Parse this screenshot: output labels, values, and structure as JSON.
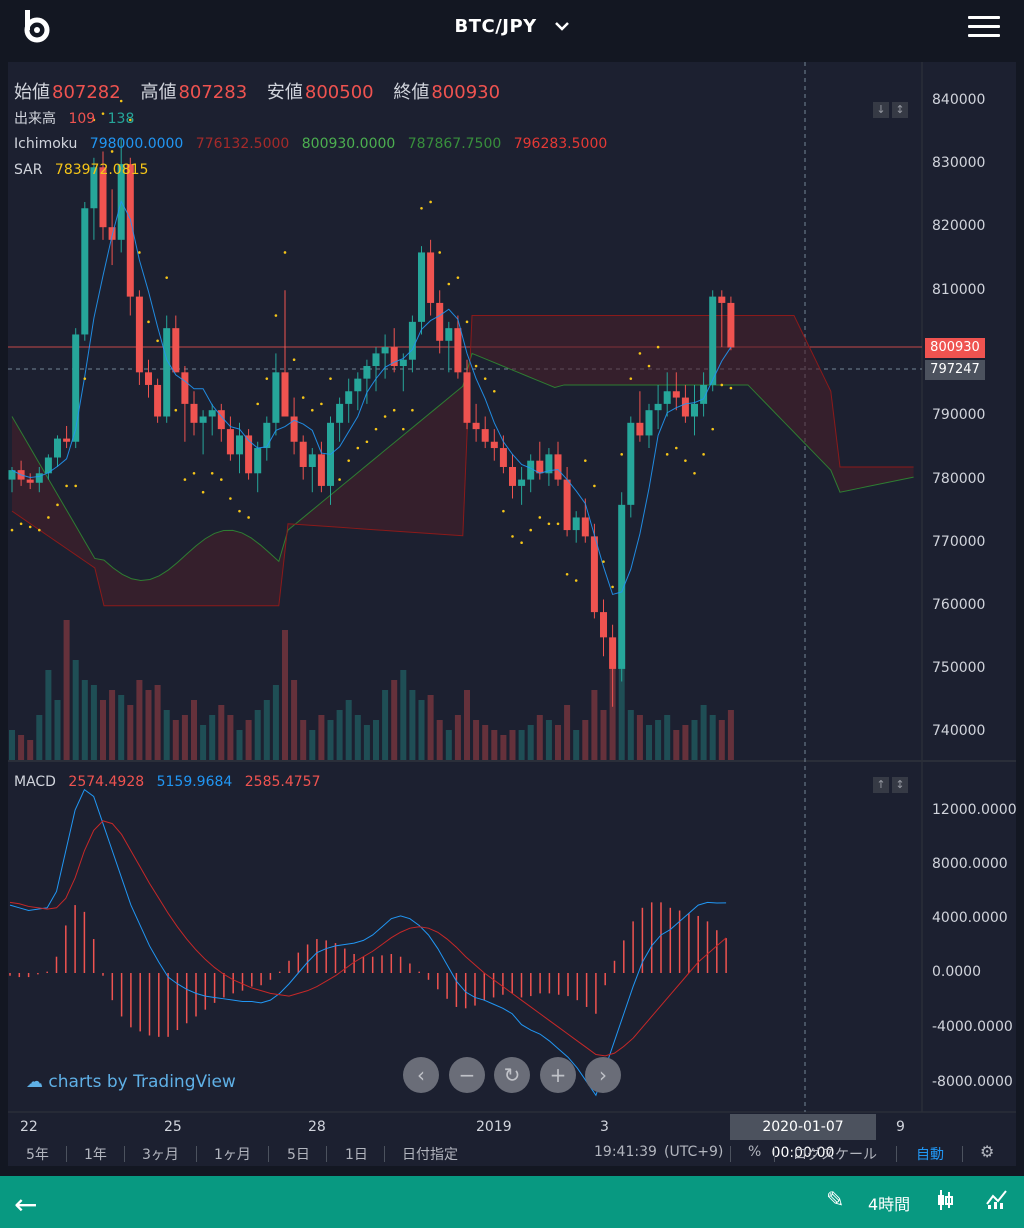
{
  "header": {
    "pair": "BTC/JPY",
    "logo": "bitbank-logo",
    "menu_icon": "hamburger-menu-icon"
  },
  "ohlc": {
    "open_label": "始値",
    "open": "807282",
    "high_label": "高値",
    "high": "807283",
    "low_label": "安値",
    "low": "800500",
    "close_label": "終値",
    "close": "800930"
  },
  "volume": {
    "label": "出来高",
    "v1": "109",
    "v2": "138"
  },
  "ichimoku": {
    "label": "Ichimoku",
    "v1": "798000.0000",
    "v2": "776132.5000",
    "v3": "800930.0000",
    "v4": "787867.7500",
    "v5": "796283.5000"
  },
  "sar": {
    "label": "SAR",
    "value": "783972.0815"
  },
  "macd": {
    "label": "MACD",
    "v1": "2574.4928",
    "v2": "5159.9684",
    "v3": "2585.4757"
  },
  "price_axis": [
    "840000",
    "830000",
    "820000",
    "810000",
    "800930",
    "797247",
    "790000",
    "780000",
    "770000",
    "760000",
    "750000",
    "740000"
  ],
  "macd_axis": [
    "12000.0000",
    "8000.0000",
    "4000.0000",
    "0.0000",
    "-4000.0000",
    "-8000.0000"
  ],
  "time_axis": [
    "22",
    "25",
    "28",
    "2019",
    "3",
    "9"
  ],
  "crosshair_time": "2020-01-07 00:00:00",
  "tradingview": "charts by TradingView",
  "toolbar": {
    "r5y": "5年",
    "r1y": "1年",
    "r3m": "3ヶ月",
    "r1m": "1ヶ月",
    "r5d": "5日",
    "r1d": "1日",
    "custom": "日付指定",
    "clock": "19:41:39",
    "tz": "(UTC+9)",
    "pct": "%",
    "log": "ログスケール",
    "auto": "自動"
  },
  "bottom": {
    "period": "4時間"
  },
  "colors": {
    "up": "#26a69a",
    "down": "#ef5350",
    "sar": "#f5c518",
    "bg": "#131722",
    "accent": "#089981",
    "auto": "#2196f3"
  },
  "chart_data": [
    {
      "type": "candlestick",
      "title": "BTC/JPY",
      "ylim": [
        735000,
        845000
      ],
      "candles": [
        [
          780000,
          782000,
          778000,
          781500
        ],
        [
          781500,
          783000,
          779000,
          780000
        ],
        [
          780000,
          781000,
          778500,
          779500
        ],
        [
          779500,
          782000,
          778000,
          781000
        ],
        [
          781000,
          784000,
          780000,
          783500
        ],
        [
          783500,
          787000,
          782000,
          786500
        ],
        [
          786500,
          788500,
          785000,
          786000
        ],
        [
          786000,
          804000,
          785000,
          803000
        ],
        [
          803000,
          824000,
          802000,
          823000
        ],
        [
          823000,
          831000,
          818000,
          829500
        ],
        [
          829500,
          832000,
          818000,
          820000
        ],
        [
          820000,
          826000,
          814000,
          818000
        ],
        [
          818000,
          834000,
          816000,
          830000
        ],
        [
          830000,
          831000,
          806000,
          809000
        ],
        [
          809000,
          810000,
          795000,
          797000
        ],
        [
          797000,
          799000,
          793000,
          795000
        ],
        [
          795000,
          796000,
          789000,
          790000
        ],
        [
          790000,
          806000,
          789000,
          804000
        ],
        [
          804000,
          806000,
          797000,
          797000
        ],
        [
          797000,
          798000,
          786000,
          792000
        ],
        [
          792000,
          794000,
          787000,
          789000
        ],
        [
          789000,
          791000,
          784000,
          790000
        ],
        [
          790000,
          792000,
          787000,
          791000
        ],
        [
          791000,
          792000,
          786000,
          788000
        ],
        [
          788000,
          790000,
          783000,
          784000
        ],
        [
          784000,
          789000,
          781000,
          787000
        ],
        [
          787000,
          788000,
          780000,
          781000
        ],
        [
          781000,
          786000,
          778000,
          785000
        ],
        [
          785000,
          790000,
          783000,
          789000
        ],
        [
          789000,
          800000,
          787000,
          797000
        ],
        [
          797000,
          810000,
          796000,
          790000
        ],
        [
          790000,
          793000,
          784000,
          786000
        ],
        [
          786000,
          787000,
          780000,
          782000
        ],
        [
          782000,
          785000,
          778000,
          784000
        ],
        [
          784000,
          786000,
          778000,
          779000
        ],
        [
          779000,
          790000,
          776000,
          789000
        ],
        [
          789000,
          793000,
          786000,
          792000
        ],
        [
          792000,
          796000,
          789000,
          794000
        ],
        [
          794000,
          797000,
          791000,
          796000
        ],
        [
          796000,
          799000,
          792000,
          798000
        ],
        [
          798000,
          801000,
          794000,
          800000
        ],
        [
          800000,
          803000,
          796000,
          801000
        ],
        [
          801000,
          804000,
          797000,
          798000
        ],
        [
          798000,
          800000,
          794000,
          799000
        ],
        [
          799000,
          806000,
          797000,
          805000
        ],
        [
          805000,
          817000,
          803000,
          816000
        ],
        [
          816000,
          818000,
          806000,
          808000
        ],
        [
          808000,
          810000,
          800000,
          802000
        ],
        [
          802000,
          805000,
          797000,
          804000
        ],
        [
          804000,
          806000,
          796000,
          797000
        ],
        [
          797000,
          799000,
          788000,
          789000
        ],
        [
          789000,
          792000,
          786000,
          788000
        ],
        [
          788000,
          790000,
          785000,
          786000
        ],
        [
          786000,
          788000,
          783000,
          785000
        ],
        [
          785000,
          787000,
          781000,
          782000
        ],
        [
          782000,
          784000,
          777000,
          779000
        ],
        [
          779000,
          782000,
          776000,
          780000
        ],
        [
          780000,
          784000,
          778000,
          783000
        ],
        [
          783000,
          786000,
          780000,
          781000
        ],
        [
          781000,
          785000,
          779000,
          784000
        ],
        [
          784000,
          786000,
          779000,
          780000
        ],
        [
          780000,
          782000,
          771000,
          772000
        ],
        [
          772000,
          775000,
          770000,
          774000
        ],
        [
          774000,
          777000,
          770000,
          771000
        ],
        [
          771000,
          773000,
          758000,
          759000
        ],
        [
          759000,
          761000,
          752000,
          755000
        ],
        [
          755000,
          757000,
          744000,
          750000
        ],
        [
          750000,
          778000,
          748000,
          776000
        ],
        [
          776000,
          790000,
          774000,
          789000
        ],
        [
          789000,
          794000,
          786000,
          787000
        ],
        [
          787000,
          792000,
          785000,
          791000
        ],
        [
          791000,
          795000,
          788000,
          792000
        ],
        [
          792000,
          797000,
          790000,
          794000
        ],
        [
          794000,
          797000,
          791000,
          793000
        ],
        [
          793000,
          795000,
          789000,
          790000
        ],
        [
          790000,
          795000,
          787000,
          792000
        ],
        [
          792000,
          797000,
          790000,
          795000
        ],
        [
          795000,
          810000,
          794000,
          809000
        ],
        [
          809000,
          810000,
          801000,
          808000
        ],
        [
          808000,
          809000,
          800500,
          800930
        ]
      ],
      "volume": [
        30,
        25,
        20,
        45,
        90,
        60,
        140,
        100,
        80,
        75,
        60,
        70,
        65,
        55,
        80,
        70,
        75,
        50,
        40,
        45,
        60,
        35,
        45,
        55,
        45,
        30,
        40,
        50,
        60,
        75,
        130,
        80,
        40,
        30,
        45,
        40,
        50,
        60,
        45,
        35,
        40,
        70,
        80,
        90,
        70,
        60,
        65,
        40,
        30,
        45,
        70,
        40,
        35,
        30,
        25,
        30,
        30,
        35,
        45,
        40,
        35,
        55,
        30,
        40,
        70,
        50,
        120,
        100,
        50,
        45,
        35,
        40,
        45,
        30,
        35,
        40,
        55,
        45,
        40,
        50
      ],
      "axis_labels": [
        "840000",
        "830000",
        "820000",
        "810000",
        "800930",
        "797247",
        "790000",
        "780000",
        "770000",
        "760000",
        "750000",
        "740000"
      ]
    },
    {
      "type": "line",
      "title": "MACD",
      "ylim": [
        -10000,
        14000
      ],
      "macd": [
        5000,
        4800,
        4600,
        4700,
        4800,
        6000,
        9000,
        12000,
        13500,
        13000,
        11000,
        9000,
        7000,
        5000,
        3500,
        2000,
        800,
        -300,
        -800,
        -1200,
        -1500,
        -1700,
        -1800,
        -1900,
        -2000,
        -2100,
        -2100,
        -2200,
        -2000,
        -1500,
        -800,
        0,
        800,
        1500,
        1800,
        2000,
        2100,
        2200,
        2400,
        2800,
        3400,
        4000,
        4200,
        4000,
        3500,
        2800,
        1800,
        600,
        -600,
        -1400,
        -1800,
        -2000,
        -2300,
        -2600,
        -3000,
        -3800,
        -4200,
        -4500,
        -5000,
        -5600,
        -6200,
        -7000,
        -8000,
        -9000,
        -7000,
        -5000,
        -3000,
        -1000,
        800,
        2000,
        2800,
        3200,
        3800,
        4400,
        5000,
        5200,
        5150,
        5160
      ],
      "signal": [
        5200,
        5100,
        4900,
        4800,
        4700,
        4800,
        5500,
        7000,
        9000,
        10500,
        11200,
        11000,
        10200,
        9000,
        7800,
        6600,
        5500,
        4400,
        3400,
        2500,
        1700,
        1000,
        400,
        -100,
        -500,
        -800,
        -1100,
        -1300,
        -1500,
        -1600,
        -1700,
        -1500,
        -1300,
        -1000,
        -600,
        -200,
        300,
        800,
        1200,
        1600,
        2100,
        2600,
        3000,
        3300,
        3400,
        3300,
        3000,
        2500,
        1900,
        1200,
        600,
        0,
        -500,
        -1000,
        -1500,
        -2000,
        -2500,
        -3000,
        -3500,
        -4000,
        -4500,
        -5000,
        -5500,
        -6000,
        -6100,
        -5900,
        -5400,
        -4800,
        -4000,
        -3200,
        -2400,
        -1600,
        -800,
        0,
        800,
        1400,
        2000,
        2585
      ],
      "histogram": [
        -200,
        -300,
        -300,
        -100,
        100,
        1200,
        3500,
        5000,
        4500,
        2500,
        -200,
        -2000,
        -3200,
        -4000,
        -4300,
        -4600,
        -4700,
        -4700,
        -4200,
        -3700,
        -3200,
        -2700,
        -2200,
        -1800,
        -1500,
        -1300,
        -1000,
        -900,
        -500,
        100,
        900,
        1500,
        2100,
        2500,
        2400,
        2200,
        1800,
        1400,
        1200,
        1200,
        1300,
        1400,
        1200,
        700,
        100,
        -500,
        -1200,
        -1900,
        -2500,
        -2600,
        -2400,
        -2000,
        -1800,
        -1600,
        -1500,
        -1800,
        -1700,
        -1500,
        -1500,
        -1600,
        -1700,
        -2000,
        -2500,
        -3000,
        -900,
        900,
        2400,
        3800,
        4800,
        5200,
        5200,
        4800,
        4600,
        4400,
        4200,
        3800,
        3150,
        2574
      ],
      "axis_labels": [
        "12000.0000",
        "8000.0000",
        "4000.0000",
        "0.0000",
        "-4000.0000",
        "-8000.0000"
      ]
    }
  ]
}
